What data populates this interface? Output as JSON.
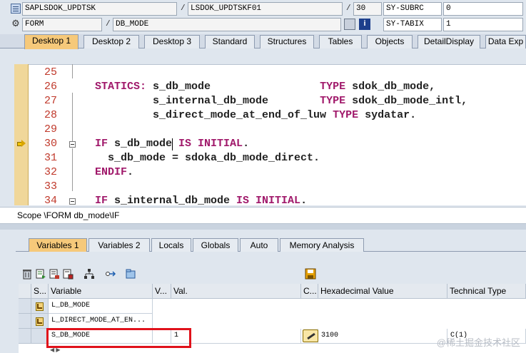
{
  "status": {
    "program": "SAPLSDOK_UPDTSK",
    "include": "LSDOK_UPDTSKF01",
    "line": "30",
    "subrc_label": "SY-SUBRC",
    "subrc_value": "0",
    "event_type": "FORM",
    "event_name": "DB_MODE",
    "tabix_label": "SY-TABIX",
    "tabix_value": "1",
    "separator": "/"
  },
  "desktop_tabs": [
    "Desktop 1",
    "Desktop 2",
    "Desktop 3",
    "Standard",
    "Structures",
    "Tables",
    "Objects",
    "DetailDisplay",
    "Data Exp"
  ],
  "code": {
    "lines": [
      {
        "no": "25",
        "text": ""
      },
      {
        "no": "26",
        "kw": "STATICS:",
        "text": " s_db_mode                 ",
        "kw2": "TYPE",
        "text2": " sdok_db_mode,"
      },
      {
        "no": "27",
        "kw": "",
        "text": "         s_internal_db_mode        ",
        "kw2": "TYPE",
        "text2": " sdok_db_mode_intl,"
      },
      {
        "no": "28",
        "kw": "",
        "text": "         s_direct_mode_at_end_of_luw ",
        "kw2": "TYPE",
        "text2": " sydatar."
      },
      {
        "no": "29",
        "text": ""
      },
      {
        "no": "30",
        "kw": "IF",
        "text": " s_db_mode ",
        "kw2": "IS INITIAL",
        "text2": "."
      },
      {
        "no": "31",
        "kw": "",
        "text": "  s_db_mode = sdoka_db_mode_direct.",
        "kw2": "",
        "text2": ""
      },
      {
        "no": "32",
        "kw": "ENDIF",
        "text": ".",
        "kw2": "",
        "text2": ""
      },
      {
        "no": "33",
        "text": ""
      },
      {
        "no": "34",
        "kw": "IF",
        "text": " s_internal_db_mode ",
        "kw2": "IS INITIAL",
        "text2": "."
      }
    ]
  },
  "scope": "Scope \\FORM db_mode\\IF",
  "variable_tabs": [
    "Variables 1",
    "Variables 2",
    "Locals",
    "Globals",
    "Auto",
    "Memory Analysis"
  ],
  "table": {
    "headers": [
      "S...",
      "Variable",
      "V...",
      "Val.",
      "C...",
      "Hexadecimal Value",
      "Technical Type"
    ],
    "rows": [
      {
        "variable": "L_DB_MODE",
        "value": "",
        "hex": "",
        "type": ""
      },
      {
        "variable": "L_DIRECT_MODE_AT_EN...",
        "value": "",
        "hex": "",
        "type": ""
      },
      {
        "variable": "S_DB_MODE",
        "value": "1",
        "hex": "3100",
        "type": "C(1)"
      }
    ]
  },
  "watermark": "@稀土掘金技术社区",
  "colors": {
    "active_tab": "#f6c97a",
    "keyword": "#a0186a",
    "highlight_box": "#e0121b",
    "line_numbers": "#c0392b"
  }
}
